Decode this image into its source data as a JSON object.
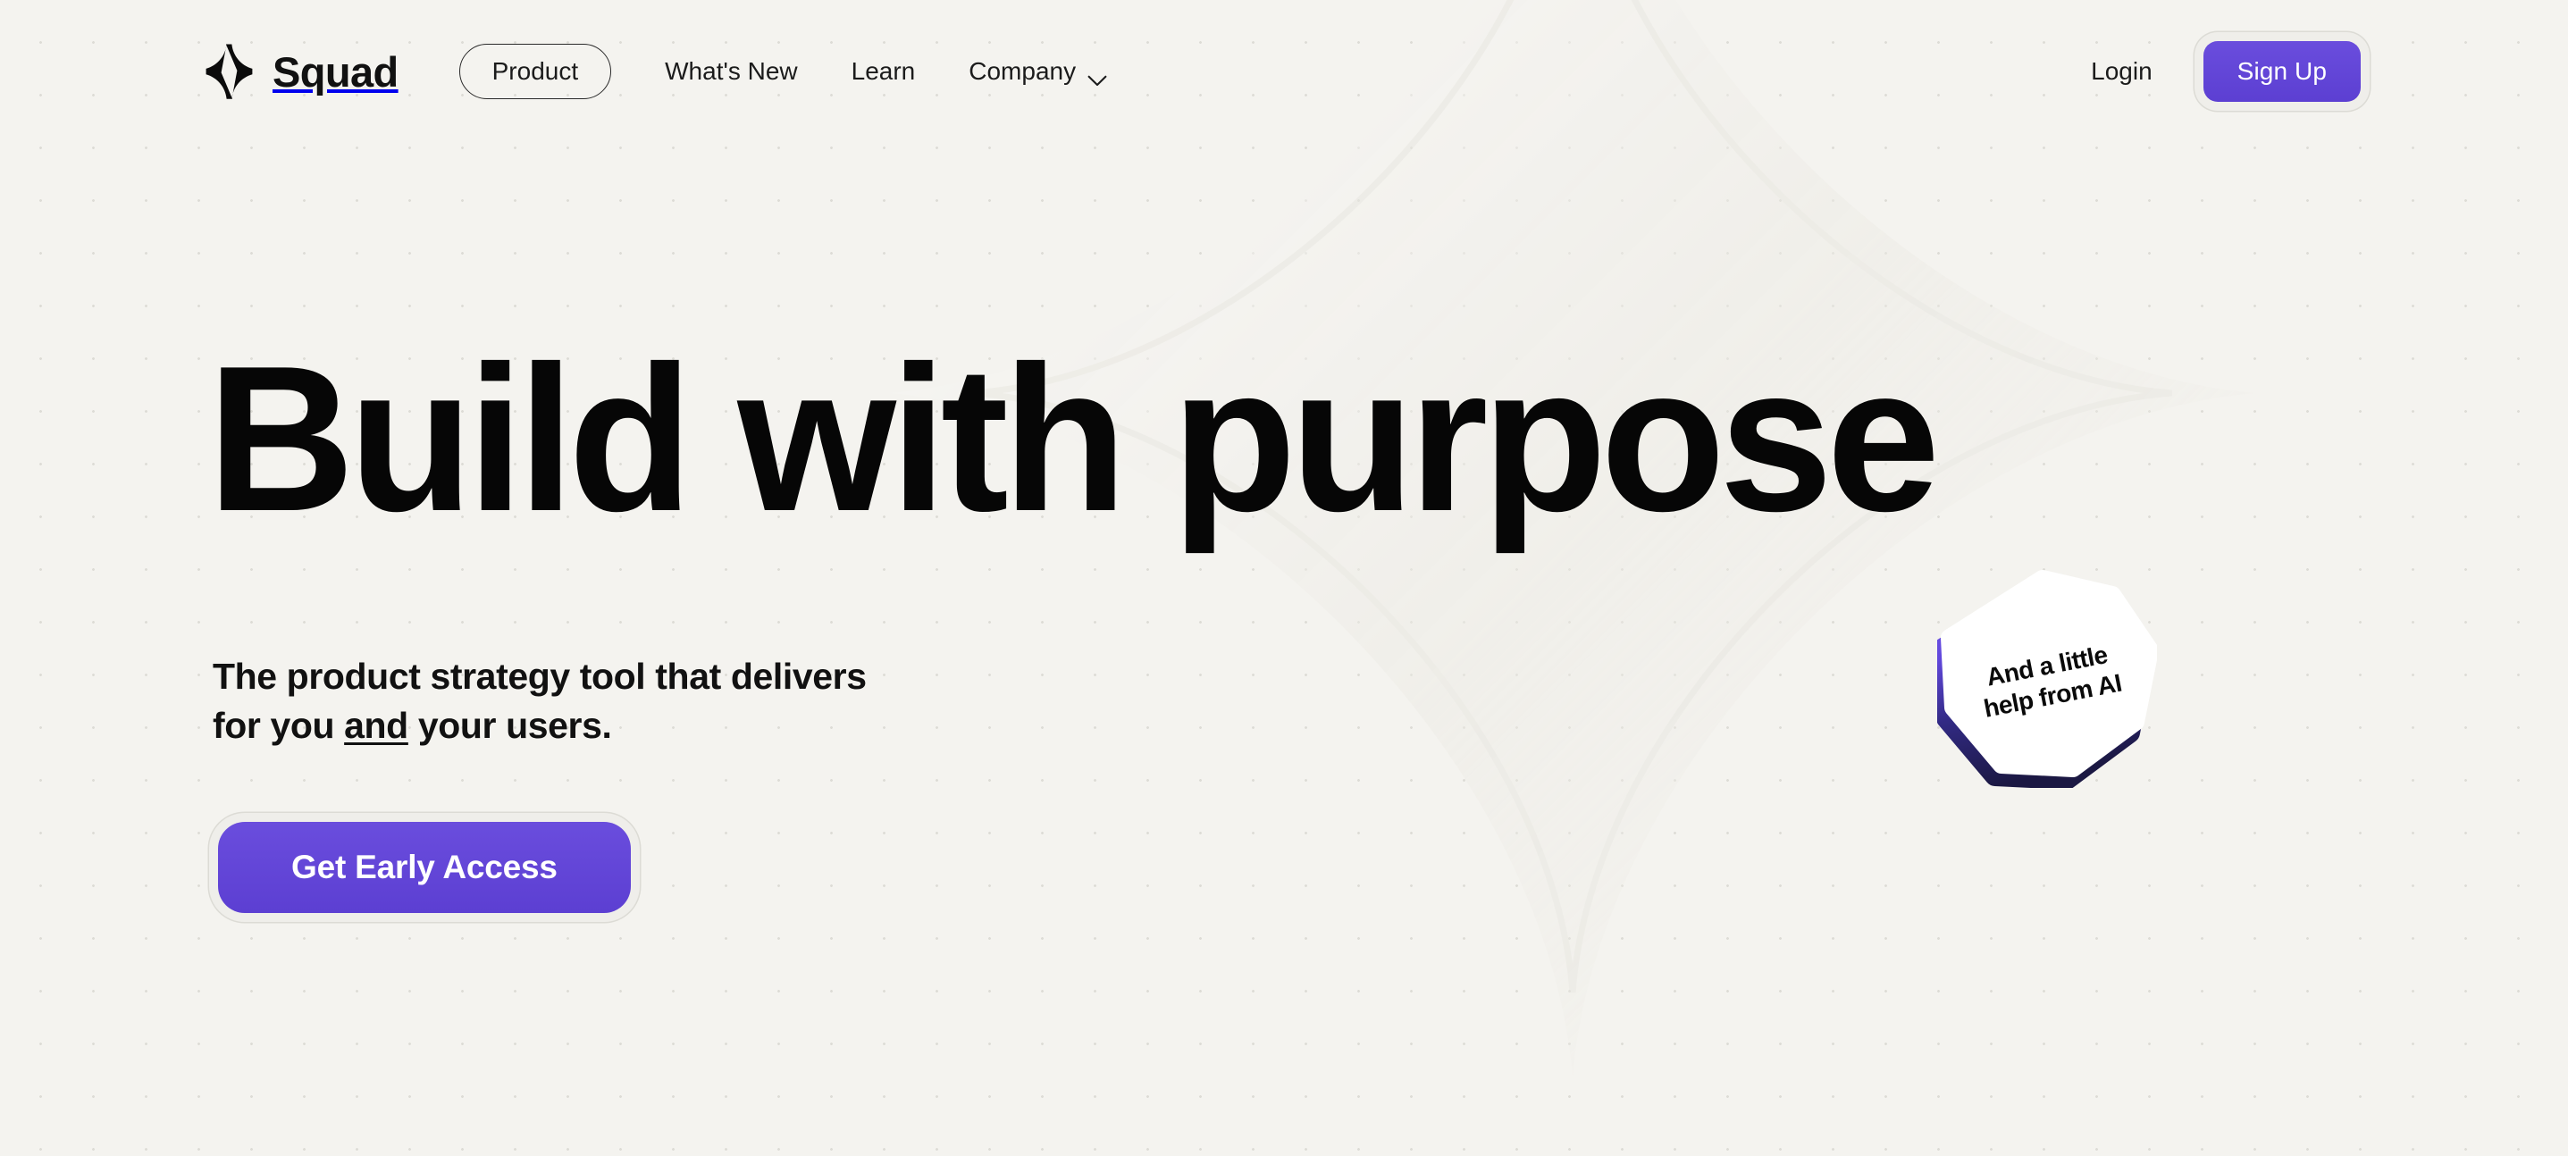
{
  "theme": {
    "background": "#f4f3ef",
    "dot_color": "#dddcd6",
    "text": "#111111",
    "accent_purple": "#6a4ddd",
    "accent_purple_dark": "#5c3fd2",
    "badge_edge_top": "#6b4fe0",
    "badge_edge_bottom": "#1e1b4b"
  },
  "header": {
    "brand": {
      "name": "Squad",
      "logo_icon": "sparkle-logo-icon"
    },
    "nav": {
      "pill": {
        "label": "Product"
      },
      "links": [
        {
          "label": "What's New",
          "has_chevron": false
        },
        {
          "label": "Learn",
          "has_chevron": false
        },
        {
          "label": "Company",
          "has_chevron": true,
          "chevron_icon": "chevron-down-icon"
        }
      ]
    },
    "login_label": "Login",
    "signup_label": "Sign Up"
  },
  "hero": {
    "headline": "Build with purpose",
    "subhead_before": "The product strategy tool that delivers for you ",
    "subhead_emphasis": "and",
    "subhead_after": " your users.",
    "cta_label": "Get Early Access",
    "badge": {
      "line1": "And a little",
      "line2": "help from AI",
      "text": "And a little help from AI",
      "shape": "rounded-heptagon"
    }
  }
}
